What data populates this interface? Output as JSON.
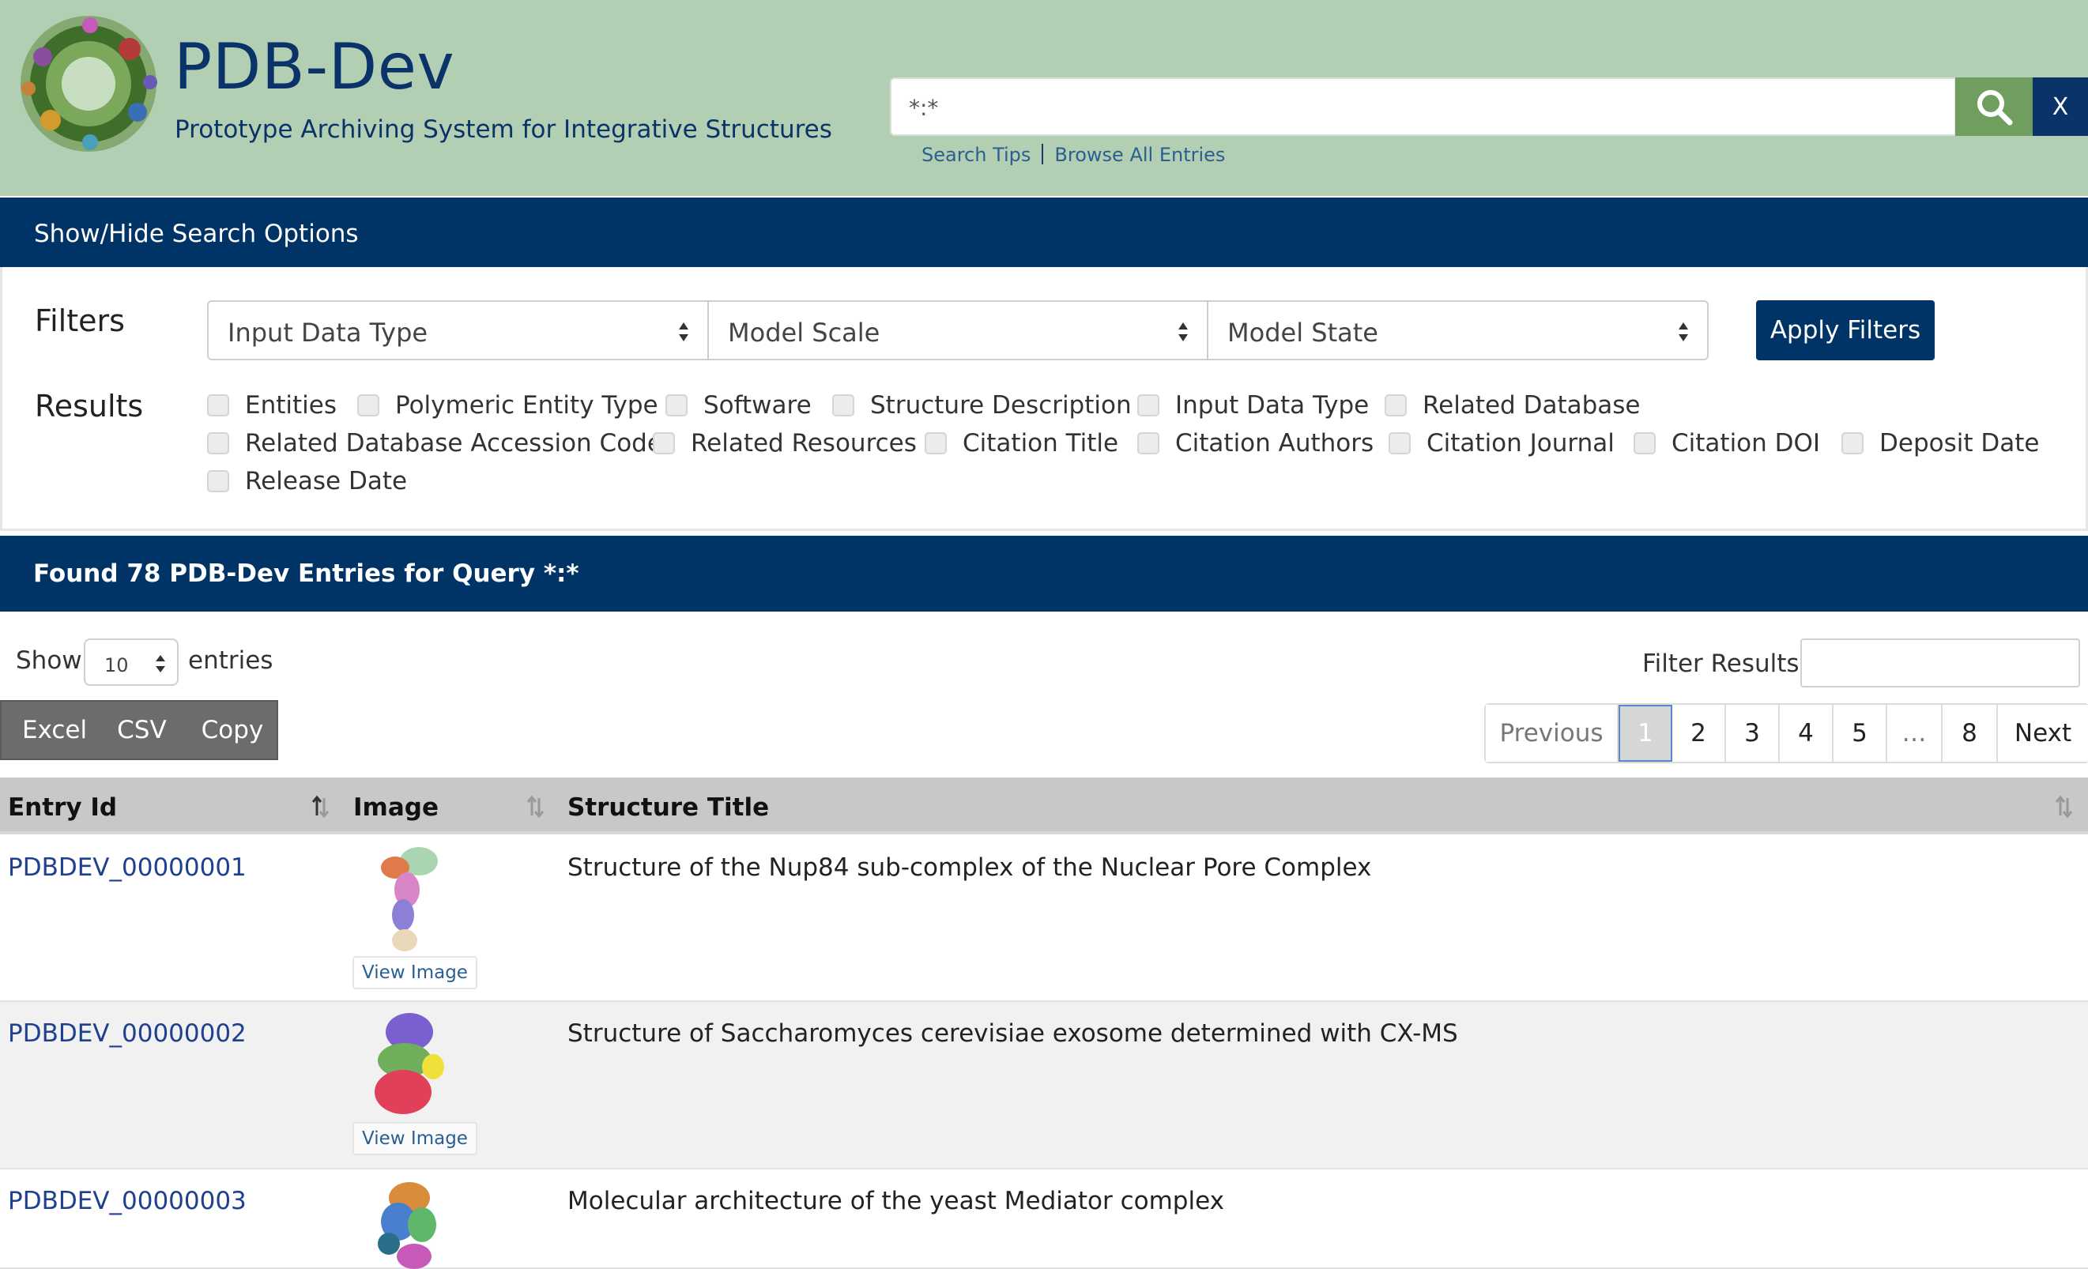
{
  "header": {
    "title": "PDB-Dev",
    "subtitle": "Prototype Archiving System for Integrative Structures"
  },
  "search": {
    "value": "*:*",
    "clear_label": "X",
    "tips_label": "Search Tips",
    "browse_label": "Browse All Entries"
  },
  "options": {
    "toggle_label": "Show/Hide Search Options",
    "filters_label": "Filters",
    "filter_selects": [
      "Input Data Type",
      "Model Scale",
      "Model State"
    ],
    "apply_label": "Apply Filters",
    "results_label": "Results",
    "result_columns": [
      "Entities",
      "Polymeric Entity Type",
      "Software",
      "Structure Description",
      "Input Data Type",
      "Related Database",
      "Related Database Accession Code",
      "Related Resources",
      "Citation Title",
      "Citation Authors",
      "Citation Journal",
      "Citation DOI",
      "Deposit Date",
      "Release Date"
    ]
  },
  "results": {
    "heading": "Found 78 PDB-Dev Entries for Query *:*",
    "show_label": "Show",
    "page_length": "10",
    "entries_label": "entries",
    "filter_label": "Filter Results:",
    "filter_value": "",
    "export_buttons": [
      "Excel",
      "CSV",
      "Copy"
    ],
    "pagination": [
      "Previous",
      "1",
      "2",
      "3",
      "4",
      "5",
      "…",
      "8",
      "Next"
    ],
    "current_page": "1",
    "columns": [
      "Entry Id",
      "Image",
      "Structure Title"
    ],
    "view_image_label": "View Image",
    "rows": [
      {
        "id": "PDBDEV_00000001",
        "title": "Structure of the Nup84 sub-complex of the Nuclear Pore Complex"
      },
      {
        "id": "PDBDEV_00000002",
        "title": "Structure of Saccharomyces cerevisiae exosome determined with CX-MS"
      },
      {
        "id": "PDBDEV_00000003",
        "title": "Molecular architecture of the yeast Mediator complex"
      }
    ]
  },
  "colors": {
    "header_bg": "#b3cfb3",
    "brand_navy": "#003366",
    "search_green": "#6f9e5f",
    "link_blue": "#1f3f8f"
  },
  "icons": {
    "logo": "protein-complex-logo",
    "search": "magnifier-icon",
    "sort": "sort-arrows-icon",
    "select": "select-arrows-icon"
  }
}
